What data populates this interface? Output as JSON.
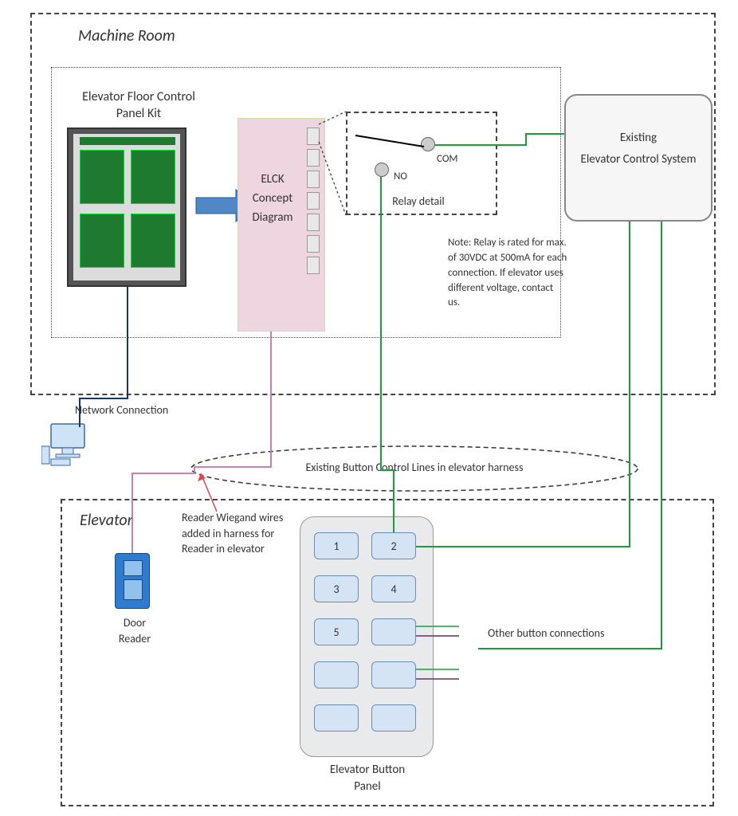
{
  "sections": {
    "machine_room_title": "Machine Room",
    "elevator_title": "Elevator"
  },
  "panel_kit_label": "Elevator Floor Control Panel Kit",
  "elck_label": "ELCK Concept Diagram",
  "existing_system_label": "Existing\nElevator Control System",
  "relay_detail_label": "Relay detail",
  "relay_com": "COM",
  "relay_no": "NO",
  "relay_note": "Note: Relay is rated for max. of 30VDC at 500mA for each connection. If elevator uses different voltage, contact us.",
  "network_label": "Network Connection",
  "harness_label": "Existing Button Control Lines in elevator harness",
  "reader_note": "Reader Wiegand wires added in harness for Reader in elevator",
  "door_reader_label": "Door Reader",
  "other_conn_label": "Other button connections",
  "button_panel_label": "Elevator Button Panel",
  "buttons": {
    "b1": "1",
    "b2": "2",
    "b3": "3",
    "b4": "4",
    "b5": "5"
  }
}
